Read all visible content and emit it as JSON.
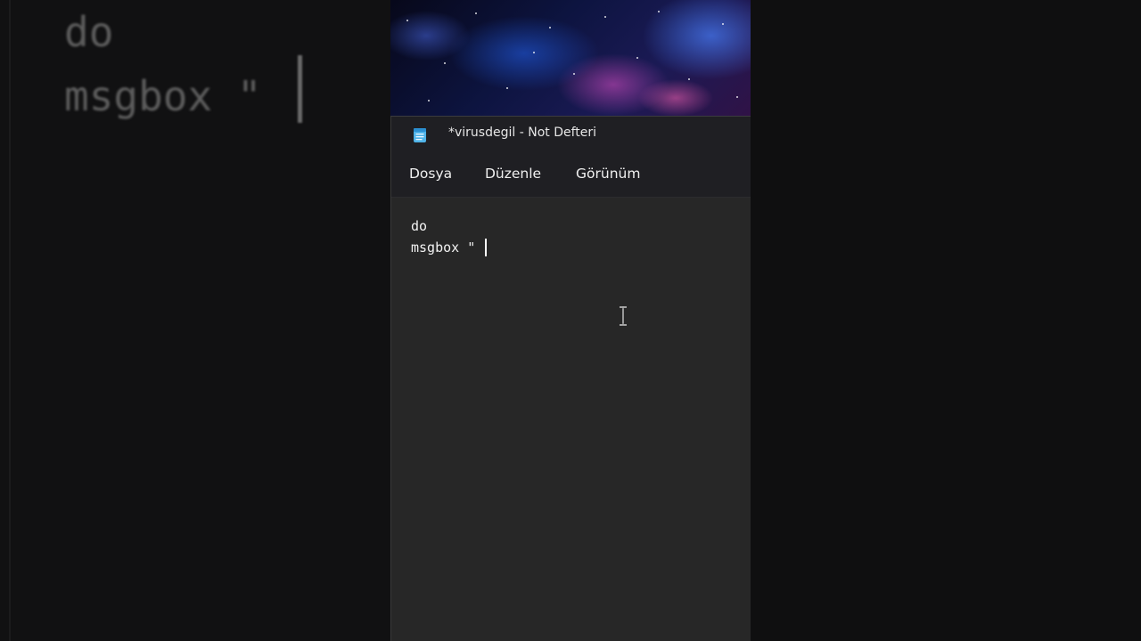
{
  "window": {
    "title": "*virusdegil - Not Defteri",
    "icon": "notepad-icon"
  },
  "menu": {
    "items": [
      {
        "label": "Dosya"
      },
      {
        "label": "Düzenle"
      },
      {
        "label": "Görünüm"
      }
    ]
  },
  "editor": {
    "lines": [
      "do",
      "msgbox \""
    ]
  },
  "background": {
    "zoomed_lines": [
      "do",
      "msgbox \""
    ]
  },
  "colors": {
    "editor_bg": "#272727",
    "titlebar_bg": "#1f1f23",
    "text": "#f2f2f2",
    "outer_bg": "#0e0e0f"
  },
  "cursor": "i-beam-cursor-icon"
}
